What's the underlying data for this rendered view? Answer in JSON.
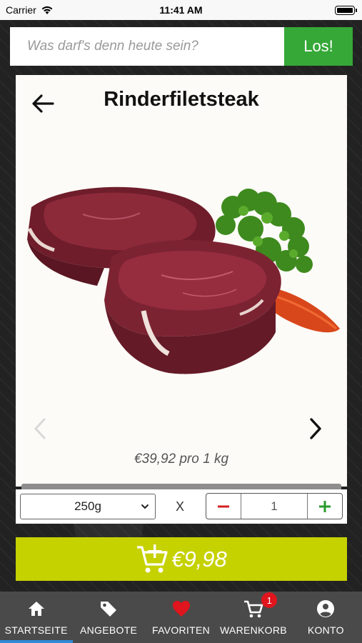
{
  "status_bar": {
    "carrier": "Carrier",
    "time": "11:41 AM"
  },
  "search": {
    "placeholder": "Was darf's denn heute sein?",
    "button_label": "Los!"
  },
  "product": {
    "title": "Rinderfiletsteak",
    "price_per_unit": "€39,92 pro 1 kg",
    "image_icon": "steak-image"
  },
  "options": {
    "weight_selected": "250g",
    "multiply_sign": "X",
    "quantity": "1",
    "minus_label": "−",
    "plus_label": "+"
  },
  "cart_button": {
    "price": "€9,98",
    "icon": "cart-add-icon"
  },
  "tabs": [
    {
      "label": "STARTSEITE",
      "icon": "home-icon"
    },
    {
      "label": "ANGEBOTE",
      "icon": "tag-icon"
    },
    {
      "label": "FAVORITEN",
      "icon": "heart-icon"
    },
    {
      "label": "WARENKORB",
      "icon": "cart-icon",
      "badge": "1"
    },
    {
      "label": "KONTO",
      "icon": "account-icon"
    }
  ],
  "colors": {
    "search_button": "#36a838",
    "cart_button": "#c6d100",
    "tab_bar": "#4a4a4a",
    "badge": "#e0151d",
    "favorite_heart": "#e0151d",
    "stepper_minus": "#d32020",
    "stepper_plus": "#2a9a2a",
    "active_tab_line": "#2f8ad8"
  }
}
